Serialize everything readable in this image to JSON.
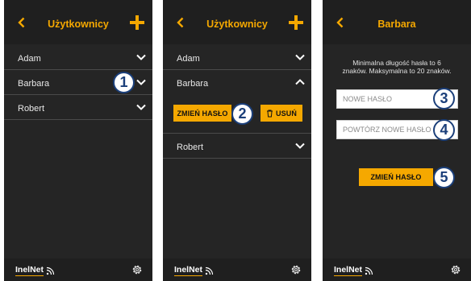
{
  "screens": [
    {
      "title": "Użytkownicy",
      "users": [
        "Adam",
        "Barbara",
        "Robert"
      ]
    },
    {
      "title": "Użytkownicy",
      "users": [
        "Adam",
        "Barbara",
        "Robert"
      ],
      "actions": {
        "change_password": "ZMIEŃ HASŁO",
        "delete": "USUŃ"
      }
    },
    {
      "title": "Barbara",
      "info": "Minimalna długość hasła to 6 znaków. Maksymalna to 20 znaków.",
      "new_password_placeholder": "NOWE HASŁO",
      "repeat_password_placeholder": "POWTÓRZ NOWE HASŁO",
      "submit": "ZMIEŃ HASŁO"
    }
  ],
  "footer": {
    "logo": "InelNet"
  },
  "callouts": [
    "1",
    "2",
    "3",
    "4",
    "5"
  ],
  "colors": {
    "accent": "#f5a800",
    "panel_bg": "#252525",
    "header_bg": "#1f1f1f",
    "callout": "#1b3f7a"
  },
  "icons": [
    "back-chevron-icon",
    "plus-icon",
    "chevron-down-icon",
    "chevron-up-icon",
    "trash-icon",
    "wifi-signal-icon",
    "gear-icon"
  ]
}
